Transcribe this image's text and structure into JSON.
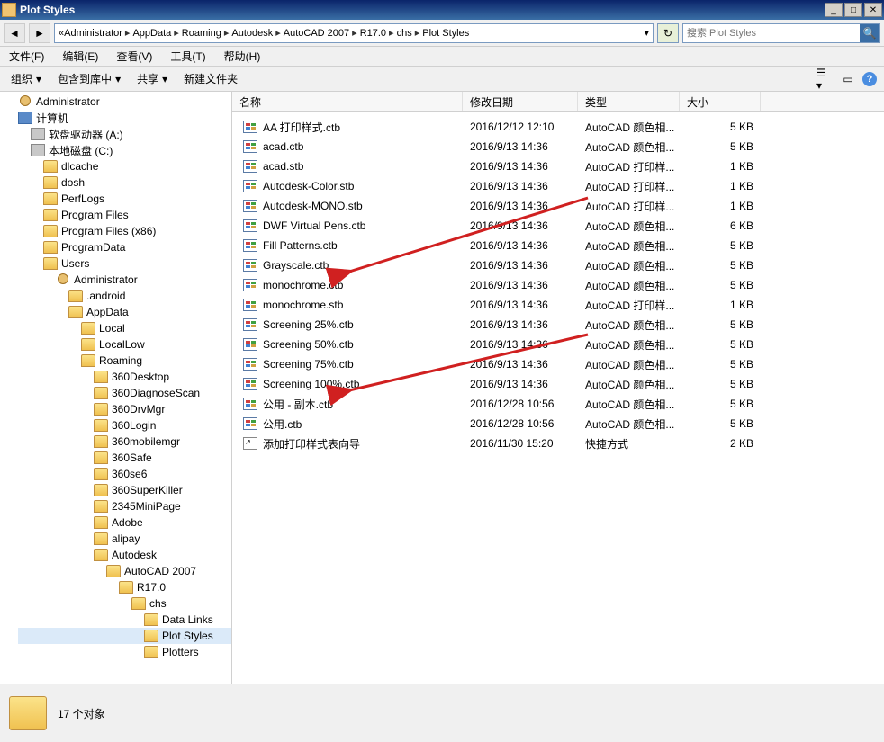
{
  "window": {
    "title": "Plot Styles"
  },
  "breadcrumbs": [
    "Administrator",
    "AppData",
    "Roaming",
    "Autodesk",
    "AutoCAD 2007",
    "R17.0",
    "chs",
    "Plot Styles"
  ],
  "search_placeholder": "搜索 Plot Styles",
  "menubar": [
    "文件(F)",
    "编辑(E)",
    "查看(V)",
    "工具(T)",
    "帮助(H)"
  ],
  "cmdbar": {
    "organize": "组织",
    "include": "包含到库中",
    "share": "共享",
    "newfolder": "新建文件夹"
  },
  "columns": {
    "name": "名称",
    "date": "修改日期",
    "type": "类型",
    "size": "大小"
  },
  "files": [
    {
      "name": "AA 打印样式.ctb",
      "date": "2016/12/12 12:10",
      "type": "AutoCAD 颜色相...",
      "size": "5 KB"
    },
    {
      "name": "acad.ctb",
      "date": "2016/9/13 14:36",
      "type": "AutoCAD 颜色相...",
      "size": "5 KB"
    },
    {
      "name": "acad.stb",
      "date": "2016/9/13 14:36",
      "type": "AutoCAD 打印样...",
      "size": "1 KB"
    },
    {
      "name": "Autodesk-Color.stb",
      "date": "2016/9/13 14:36",
      "type": "AutoCAD 打印样...",
      "size": "1 KB"
    },
    {
      "name": "Autodesk-MONO.stb",
      "date": "2016/9/13 14:36",
      "type": "AutoCAD 打印样...",
      "size": "1 KB"
    },
    {
      "name": "DWF Virtual Pens.ctb",
      "date": "2016/9/13 14:36",
      "type": "AutoCAD 颜色相...",
      "size": "6 KB"
    },
    {
      "name": "Fill Patterns.ctb",
      "date": "2016/9/13 14:36",
      "type": "AutoCAD 颜色相...",
      "size": "5 KB"
    },
    {
      "name": "Grayscale.ctb",
      "date": "2016/9/13 14:36",
      "type": "AutoCAD 颜色相...",
      "size": "5 KB"
    },
    {
      "name": "monochrome.ctb",
      "date": "2016/9/13 14:36",
      "type": "AutoCAD 颜色相...",
      "size": "5 KB"
    },
    {
      "name": "monochrome.stb",
      "date": "2016/9/13 14:36",
      "type": "AutoCAD 打印样...",
      "size": "1 KB"
    },
    {
      "name": "Screening 25%.ctb",
      "date": "2016/9/13 14:36",
      "type": "AutoCAD 颜色相...",
      "size": "5 KB"
    },
    {
      "name": "Screening 50%.ctb",
      "date": "2016/9/13 14:36",
      "type": "AutoCAD 颜色相...",
      "size": "5 KB"
    },
    {
      "name": "Screening 75%.ctb",
      "date": "2016/9/13 14:36",
      "type": "AutoCAD 颜色相...",
      "size": "5 KB"
    },
    {
      "name": "Screening 100%.ctb",
      "date": "2016/9/13 14:36",
      "type": "AutoCAD 颜色相...",
      "size": "5 KB"
    },
    {
      "name": "公用 - 副本.ctb",
      "date": "2016/12/28 10:56",
      "type": "AutoCAD 颜色相...",
      "size": "5 KB"
    },
    {
      "name": "公用.ctb",
      "date": "2016/12/28 10:56",
      "type": "AutoCAD 颜色相...",
      "size": "5 KB"
    },
    {
      "name": "添加打印样式表向导",
      "date": "2016/11/30 15:20",
      "type": "快捷方式",
      "size": "2 KB",
      "shortcut": true
    }
  ],
  "tree": [
    {
      "label": "Administrator",
      "indent": 0,
      "ico": "user"
    },
    {
      "label": "计算机",
      "indent": 0,
      "ico": "comp"
    },
    {
      "label": "软盘驱动器 (A:)",
      "indent": 1,
      "ico": "drive"
    },
    {
      "label": "本地磁盘 (C:)",
      "indent": 1,
      "ico": "drive"
    },
    {
      "label": "dlcache",
      "indent": 2,
      "ico": "folder"
    },
    {
      "label": "dosh",
      "indent": 2,
      "ico": "folder"
    },
    {
      "label": "PerfLogs",
      "indent": 2,
      "ico": "folder"
    },
    {
      "label": "Program Files",
      "indent": 2,
      "ico": "folder"
    },
    {
      "label": "Program Files (x86)",
      "indent": 2,
      "ico": "folder"
    },
    {
      "label": "ProgramData",
      "indent": 2,
      "ico": "folder"
    },
    {
      "label": "Users",
      "indent": 2,
      "ico": "folder"
    },
    {
      "label": "Administrator",
      "indent": 3,
      "ico": "user"
    },
    {
      "label": ".android",
      "indent": 4,
      "ico": "folder"
    },
    {
      "label": "AppData",
      "indent": 4,
      "ico": "folder"
    },
    {
      "label": "Local",
      "indent": 5,
      "ico": "folder"
    },
    {
      "label": "LocalLow",
      "indent": 5,
      "ico": "folder"
    },
    {
      "label": "Roaming",
      "indent": 5,
      "ico": "folder"
    },
    {
      "label": "360Desktop",
      "indent": 6,
      "ico": "folder"
    },
    {
      "label": "360DiagnoseScan",
      "indent": 6,
      "ico": "folder"
    },
    {
      "label": "360DrvMgr",
      "indent": 6,
      "ico": "folder"
    },
    {
      "label": "360Login",
      "indent": 6,
      "ico": "folder"
    },
    {
      "label": "360mobilemgr",
      "indent": 6,
      "ico": "folder"
    },
    {
      "label": "360Safe",
      "indent": 6,
      "ico": "folder"
    },
    {
      "label": "360se6",
      "indent": 6,
      "ico": "folder"
    },
    {
      "label": "360SuperKiller",
      "indent": 6,
      "ico": "folder"
    },
    {
      "label": "2345MiniPage",
      "indent": 6,
      "ico": "folder"
    },
    {
      "label": "Adobe",
      "indent": 6,
      "ico": "folder"
    },
    {
      "label": "alipay",
      "indent": 6,
      "ico": "folder"
    },
    {
      "label": "Autodesk",
      "indent": 6,
      "ico": "folder"
    },
    {
      "label": "AutoCAD 2007",
      "indent": 7,
      "ico": "folder"
    },
    {
      "label": "R17.0",
      "indent": 8,
      "ico": "folder"
    },
    {
      "label": "chs",
      "indent": 9,
      "ico": "folder"
    },
    {
      "label": "Data Links",
      "indent": 10,
      "ico": "folder"
    },
    {
      "label": "Plot Styles",
      "indent": 10,
      "ico": "folder",
      "selected": true
    },
    {
      "label": "Plotters",
      "indent": 10,
      "ico": "folder"
    }
  ],
  "status": {
    "text": "17 个对象"
  }
}
